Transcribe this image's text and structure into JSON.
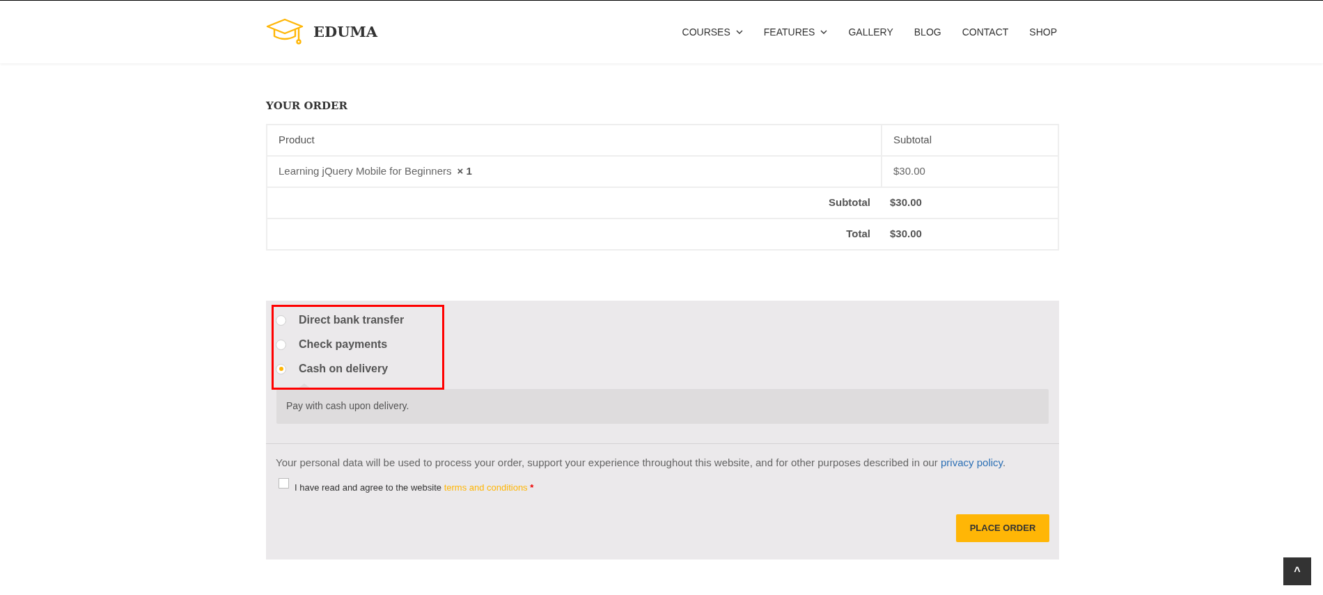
{
  "header": {
    "logo": "EDUMA",
    "nav": [
      {
        "label": "COURSES",
        "dropdown": true
      },
      {
        "label": "FEATURES",
        "dropdown": true
      },
      {
        "label": "GALLERY",
        "dropdown": false
      },
      {
        "label": "BLOG",
        "dropdown": false
      },
      {
        "label": "CONTACT",
        "dropdown": false
      },
      {
        "label": "SHOP",
        "dropdown": false
      }
    ]
  },
  "order": {
    "title": "YOUR ORDER",
    "columns": [
      "Product",
      "Subtotal"
    ],
    "items": [
      {
        "name": "Learning jQuery Mobile for Beginners",
        "quantity": "× 1",
        "price": "$30.00"
      }
    ],
    "totals": [
      {
        "label": "Subtotal",
        "value": "$30.00"
      },
      {
        "label": "Total",
        "value": "$30.00"
      }
    ]
  },
  "payment": {
    "methods": [
      {
        "label": "Direct bank transfer",
        "selected": false
      },
      {
        "label": "Check payments",
        "selected": false
      },
      {
        "label": "Cash on delivery",
        "selected": true
      }
    ],
    "description": "Pay with cash upon delivery.",
    "privacy_text": "Your personal data will be used to process your order, support your experience throughout this website, and for other purposes described in our ",
    "privacy_link": "privacy policy",
    "privacy_end": ".",
    "terms": {
      "text": "I have read and agree to the website ",
      "link": "terms and conditions",
      "required": "*",
      "checked": false
    },
    "button": "PLACE ORDER"
  },
  "back_to_top": "^"
}
